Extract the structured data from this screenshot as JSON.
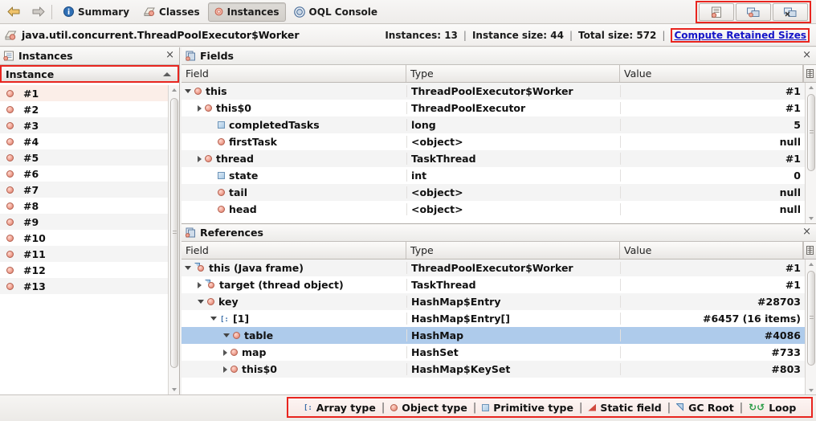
{
  "toolbar": {
    "back_icon": "back-arrow-icon",
    "forward_icon": "forward-arrow-icon",
    "tabs": [
      {
        "label": "Summary",
        "icon": "info-icon",
        "selected": false
      },
      {
        "label": "Classes",
        "icon": "classes-icon",
        "selected": false
      },
      {
        "label": "Instances",
        "icon": "instance-icon",
        "selected": true
      },
      {
        "label": "OQL Console",
        "icon": "oql-icon",
        "selected": false
      }
    ],
    "right_buttons": [
      {
        "name": "show-instances-button",
        "icon": "document-instance-icon"
      },
      {
        "name": "show-nearest-gc-root-button",
        "icon": "gc-root-icon"
      },
      {
        "name": "show-in-threads-button",
        "icon": "threads-icon"
      }
    ],
    "highlight_color": "#e8251f"
  },
  "infobar": {
    "class_icon": "class-icon",
    "class_name": "java.util.concurrent.ThreadPoolExecutor$Worker",
    "instances_label": "Instances: 13",
    "instance_size_label": "Instance size: 44",
    "total_size_label": "Total size: 572",
    "separator": "|",
    "compute_link": "Compute Retained Sizes",
    "link_color": "#1414c8"
  },
  "instances_panel": {
    "title": "Instances",
    "title_icon": "instances-panel-icon",
    "close_icon": "close-icon",
    "column_header": "Instance",
    "sort_icon": "sort-ascending-caret",
    "rows": [
      {
        "label": "#1"
      },
      {
        "label": "#2"
      },
      {
        "label": "#3"
      },
      {
        "label": "#4"
      },
      {
        "label": "#5"
      },
      {
        "label": "#6"
      },
      {
        "label": "#7"
      },
      {
        "label": "#8"
      },
      {
        "label": "#9"
      },
      {
        "label": "#10"
      },
      {
        "label": "#11"
      },
      {
        "label": "#12"
      },
      {
        "label": "#13"
      }
    ],
    "selected_index": 0
  },
  "fields_panel": {
    "title": "Fields",
    "title_icon": "fields-panel-icon",
    "close_icon": "close-icon",
    "columns": [
      "Field",
      "Type",
      "Value"
    ],
    "column_chooser_icon": "column-chooser-icon",
    "rows": [
      {
        "field": "this",
        "type": "ThreadPoolExecutor$Worker",
        "value": "#1",
        "indent": 0,
        "twisty": "open",
        "icon": "object-icon"
      },
      {
        "field": "this$0",
        "type": "ThreadPoolExecutor",
        "value": "#1",
        "indent": 1,
        "twisty": "closed",
        "icon": "object-icon"
      },
      {
        "field": "completedTasks",
        "type": "long",
        "value": "5",
        "indent": 2,
        "twisty": "none",
        "icon": "primitive-icon"
      },
      {
        "field": "firstTask",
        "type": "<object>",
        "value": "null",
        "indent": 2,
        "twisty": "none",
        "icon": "object-icon"
      },
      {
        "field": "thread",
        "type": "TaskThread",
        "value": "#1",
        "indent": 1,
        "twisty": "closed",
        "icon": "object-icon"
      },
      {
        "field": "state",
        "type": "int",
        "value": "0",
        "indent": 2,
        "twisty": "none",
        "icon": "primitive-icon"
      },
      {
        "field": "tail",
        "type": "<object>",
        "value": "null",
        "indent": 2,
        "twisty": "none",
        "icon": "object-icon"
      },
      {
        "field": "head",
        "type": "<object>",
        "value": "null",
        "indent": 2,
        "twisty": "none",
        "icon": "object-icon"
      }
    ]
  },
  "references_panel": {
    "title": "References",
    "title_icon": "references-panel-icon",
    "close_icon": "close-icon",
    "columns": [
      "Field",
      "Type",
      "Value"
    ],
    "column_chooser_icon": "column-chooser-icon",
    "rows": [
      {
        "field": "this (Java frame)",
        "type": "ThreadPoolExecutor$Worker",
        "value": "#1",
        "indent": 0,
        "twisty": "open",
        "icon": "gc-root-object-icon",
        "selected": false
      },
      {
        "field": "target (thread object)",
        "type": "TaskThread",
        "value": "#1",
        "indent": 1,
        "twisty": "closed",
        "icon": "gc-root-object-icon",
        "selected": false
      },
      {
        "field": "key",
        "type": "HashMap$Entry",
        "value": "#28703",
        "indent": 1,
        "twisty": "open",
        "icon": "object-icon",
        "selected": false
      },
      {
        "field": "[1]",
        "type": "HashMap$Entry[]",
        "value": "#6457 (16 items)",
        "indent": 2,
        "twisty": "open",
        "icon": "array-icon",
        "selected": false
      },
      {
        "field": "table",
        "type": "HashMap",
        "value": "#4086",
        "indent": 3,
        "twisty": "open",
        "icon": "object-icon",
        "selected": true
      },
      {
        "field": "map",
        "type": "HashSet",
        "value": "#733",
        "indent": 3,
        "twisty": "closed",
        "icon": "object-icon",
        "selected": false
      },
      {
        "field": "this$0",
        "type": "HashMap$KeySet",
        "value": "#803",
        "indent": 3,
        "twisty": "closed",
        "icon": "object-icon",
        "selected": false
      }
    ],
    "selection_color": "#aecbeb"
  },
  "legend": {
    "items": [
      {
        "label": "Array type",
        "icon": "array-icon"
      },
      {
        "label": "Object type",
        "icon": "object-icon"
      },
      {
        "label": "Primitive type",
        "icon": "primitive-icon"
      },
      {
        "label": "Static field",
        "icon": "static-field-icon"
      },
      {
        "label": "GC Root",
        "icon": "gc-root-icon"
      },
      {
        "label": "Loop",
        "icon": "loop-icon"
      }
    ],
    "separator": "|",
    "loop_glyph": "↻↺",
    "border_color": "#e8251f"
  }
}
